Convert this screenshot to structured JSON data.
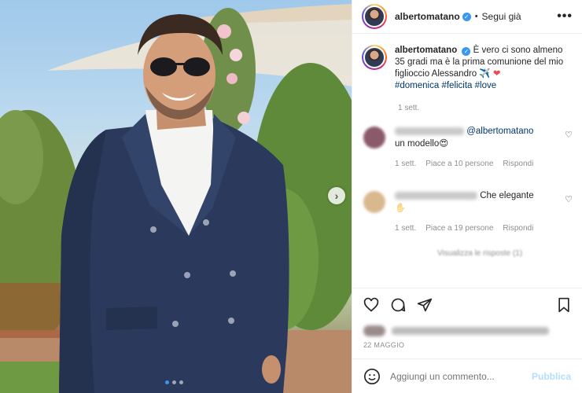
{
  "post": {
    "username": "albertomatano",
    "follow_label": "Segui già",
    "more_label": "•••",
    "verified_label": "✓",
    "bullet": "•"
  },
  "photo": {
    "next_icon": "›",
    "carousel_dots": 3,
    "active_dot": 0
  },
  "caption": {
    "username": "albertomatano",
    "text": "È vero ci sono almeno 35 gradi ma è la prima comunione del mio figlioccio Alessandro ✈️",
    "heart": "❤",
    "hashtags": "#domenica #felicita #love",
    "time": "1 sett."
  },
  "comments": [
    {
      "mention": "@albertomatano",
      "text": "un modello😍",
      "time": "1 sett.",
      "likes": "Piace a 10 persone",
      "reply": "Rispondi",
      "avatar_color": "#8a5a6b"
    },
    {
      "mention": "",
      "text": "Che elegante",
      "text2": "✋",
      "time": "1 sett.",
      "likes": "Piace a 19 persone",
      "reply": "Rispondi",
      "avatar_color": "#d9b88e"
    }
  ],
  "view_replies": "Visualizza le risposte (1)",
  "date": "22 MAGGIO",
  "add_comment": {
    "placeholder": "Aggiungi un commento...",
    "publish_label": "Pubblica"
  },
  "colors": {
    "link": "#00376b",
    "muted": "#8e8e8e",
    "verified": "#3897f0",
    "publish": "#b2dffc"
  }
}
